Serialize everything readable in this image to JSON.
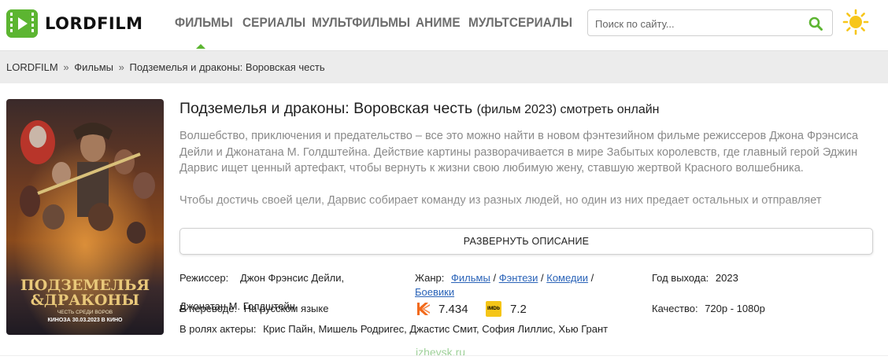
{
  "header": {
    "logo_text": "LORDFILM",
    "nav": [
      "ФИЛЬМЫ",
      "СЕРИАЛЫ",
      "МУЛЬТФИЛЬМЫ",
      "АНИМЕ",
      "МУЛЬТСЕРИАЛЫ"
    ],
    "search_placeholder": "Поиск по сайту..."
  },
  "breadcrumb": {
    "items": [
      "LORDFILM",
      "Фильмы",
      "Подземелья и драконы: Воровская честь"
    ],
    "separator": "»"
  },
  "movie": {
    "title": "Подземелья и драконы: Воровская честь",
    "title_suffix": "(фильм 2023) смотреть онлайн",
    "description_1": "Волшебство, приключения и предательство – все это можно найти в новом фэнтезийном фильме режиссеров Джона Фрэнсиса Дейли и Джонатана М. Голдштейна. Действие картины разворачивается в мире Забытых королевств, где главный герой Эджин Дарвис ищет ценный артефакт, чтобы вернуть к жизни свою любимую жену, ставшую жертвой Красного волшебника.",
    "description_2": "Чтобы достичь своей цели, Дарвис собирает команду из разных людей, но один из них предает остальных и отправляет",
    "expand_label": "РАЗВЕРНУТЬ ОПИСАНИЕ",
    "poster": {
      "title_line1": "ПОДЗЕМЕЛЬЯ",
      "title_line2": "&ДРАКОНЫ",
      "tagline": "ЧЕСТЬ СРЕДИ ВОРОВ",
      "release": "КИНОЗА 30.03.2023 В КИНО"
    },
    "director_label": "Режиссер:",
    "director_value_1": "Джон Фрэнсис Дейли,",
    "director_value_2": "Джонатан М. Голдштейн",
    "translation_label": "В переводе:",
    "translation_value": "На русском языке",
    "actors_label": "В ролях актеры:",
    "actors_value": "Крис Пайн, Мишель Родригес, Джастис Смит, София Лиллис, Хью Грант",
    "genre_label": "Жанр:",
    "genres": [
      "Фильмы",
      "Фэнтези",
      "Комедии",
      "Боевики"
    ],
    "genre_sep": "/",
    "kp_rating": "7.434",
    "imdb_label": "IMDb",
    "imdb_rating": "7.2",
    "year_label": "Год выхода:",
    "year_value": "2023",
    "quality_label": "Качество:",
    "quality_value": "720p - 1080p"
  },
  "watermark": "izhevsk.ru",
  "colors": {
    "brand_green": "#5cb531",
    "link_blue": "#2a63b8",
    "kp_orange": "#f26a1b",
    "imdb_yellow": "#f5c518",
    "sun_yellow": "#f7c61b"
  }
}
